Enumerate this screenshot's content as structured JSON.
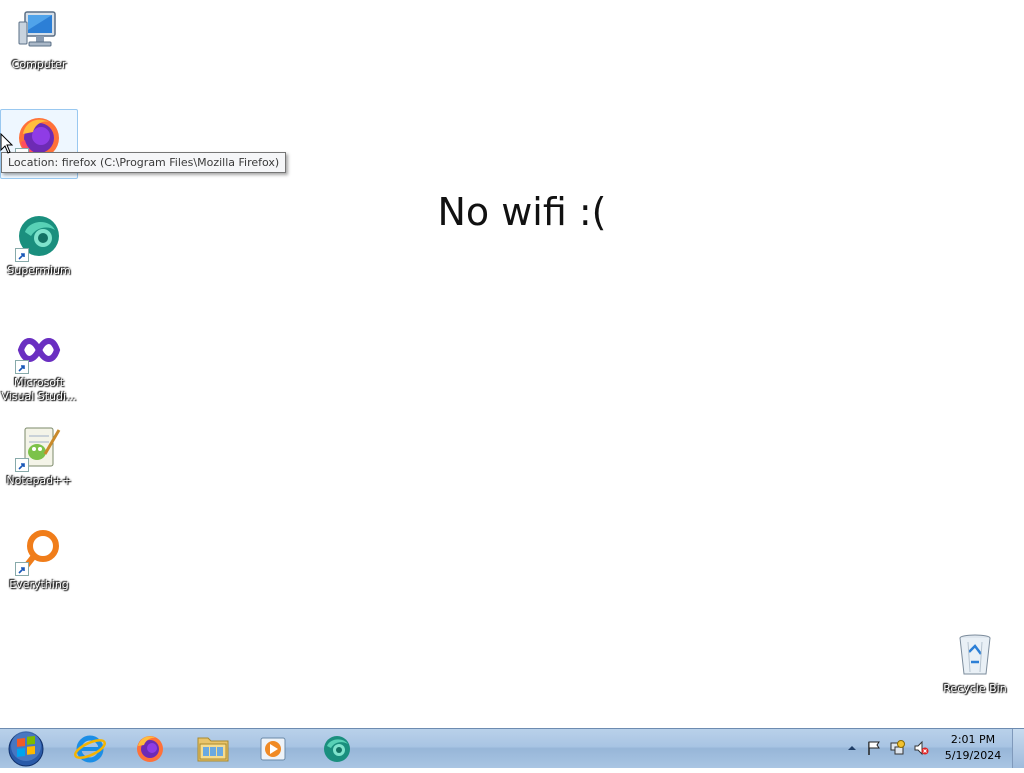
{
  "desktop": {
    "wallpaper_text": "No wifi :(",
    "background": "#ffffff",
    "icons": [
      {
        "label": "Computer",
        "icon": "computer-icon"
      },
      {
        "label": "Firefox",
        "icon": "firefox-icon"
      },
      {
        "label": "Supermium",
        "icon": "supermium-icon"
      },
      {
        "label": "Microsoft Visual Studi...",
        "icon": "visual-studio-icon"
      },
      {
        "label": "Notepad++",
        "icon": "notepadpp-icon"
      },
      {
        "label": "Everything",
        "icon": "everything-icon"
      },
      {
        "label": "Recycle Bin",
        "icon": "recycle-bin-icon"
      }
    ],
    "tooltip": "Location: firefox (C:\\Program Files\\Mozilla Firefox)"
  },
  "taskbar": {
    "start_icon": "windows-start-icon",
    "pinned": [
      {
        "name": "Internet Explorer",
        "icon": "internet-explorer-icon"
      },
      {
        "name": "Firefox",
        "icon": "firefox-icon"
      },
      {
        "name": "Windows Explorer",
        "icon": "folder-icon"
      },
      {
        "name": "Windows Media Player",
        "icon": "media-player-icon"
      },
      {
        "name": "Supermium",
        "icon": "supermium-icon"
      }
    ],
    "tray": {
      "icons": [
        "show-hidden-icons-arrow",
        "action-center-flag-icon",
        "network-icon",
        "volume-muted-icon"
      ],
      "time": "2:01 PM",
      "date": "5/19/2024"
    }
  }
}
